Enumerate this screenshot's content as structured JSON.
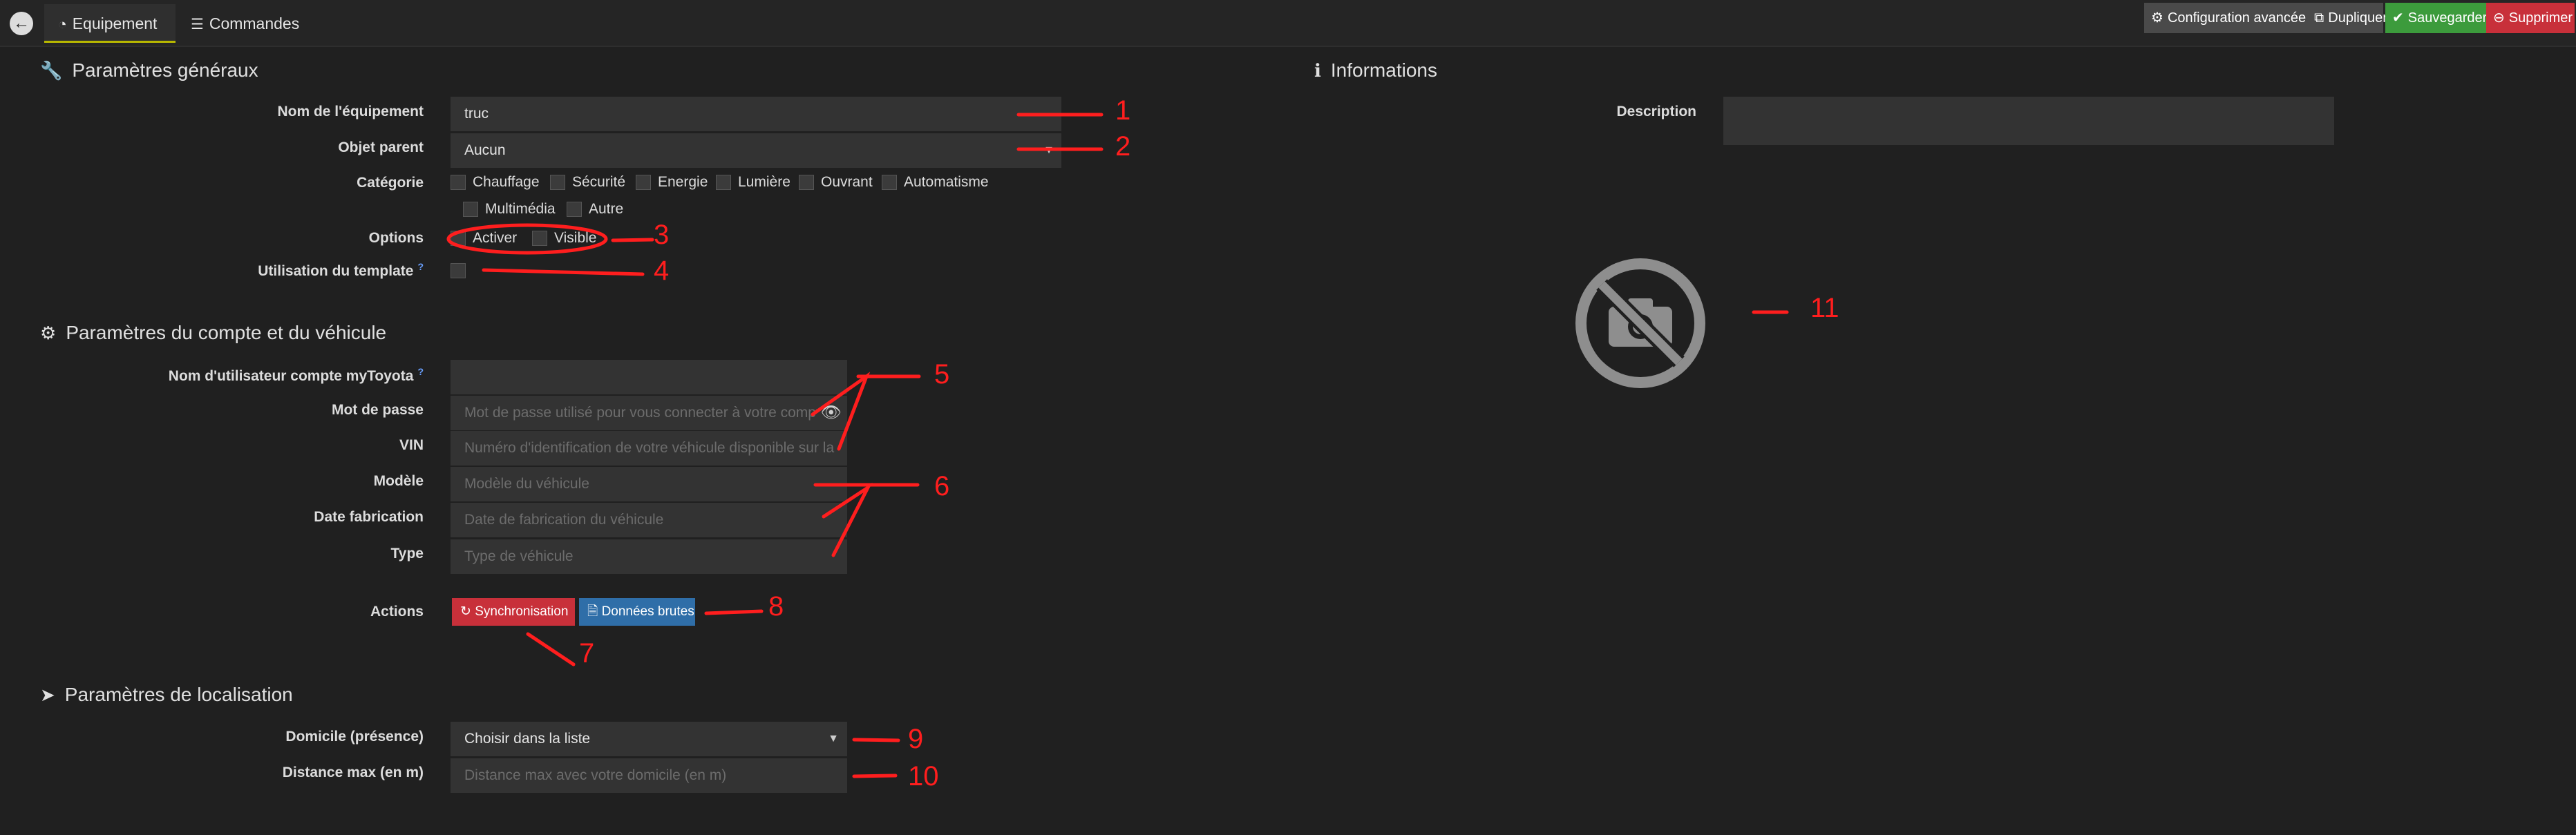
{
  "tabs": [
    {
      "label": "Equipement",
      "icon": "gauge-icon"
    },
    {
      "label": "Commandes",
      "icon": "list-icon"
    }
  ],
  "toolbar": {
    "config_label": "Configuration avancée",
    "duplicate_label": "Dupliquer",
    "save_label": "Sauvegarder",
    "delete_label": "Supprimer",
    "colors": {
      "config": "#4a4a4a",
      "duplicate": "#4a4a4a",
      "save": "#3c9b3c",
      "delete": "#c8303a"
    }
  },
  "general": {
    "title": "Paramètres généraux",
    "name_label": "Nom de l'équipement",
    "name_value": "truc",
    "parent_label": "Objet parent",
    "parent_value": "Aucun",
    "category_label": "Catégorie",
    "categories": [
      "Chauffage",
      "Sécurité",
      "Energie",
      "Lumière",
      "Ouvrant",
      "Automatisme",
      "Multimédia",
      "Autre"
    ],
    "options_label": "Options",
    "opt_activer": "Activer",
    "opt_visible": "Visible",
    "template_label": "Utilisation du template",
    "help_mark": "?"
  },
  "account": {
    "title": "Paramètres du compte et du véhicule",
    "user_label": "Nom d'utilisateur compte myToyota",
    "user_value": "",
    "password_label": "Mot de passe",
    "password_placeholder": "Mot de passe utilisé pour vous connecter à votre compte",
    "vin_label": "VIN",
    "vin_placeholder": "Numéro d'identification de votre véhicule disponible sur la",
    "model_label": "Modèle",
    "model_placeholder": "Modèle du véhicule",
    "date_label": "Date fabrication",
    "date_placeholder": "Date de fabrication du véhicule",
    "type_label": "Type",
    "type_placeholder": "Type de véhicule",
    "actions_label": "Actions",
    "sync_label": "Synchronisation",
    "raw_label": "Données brutes",
    "colors": {
      "sync": "#c8303a",
      "raw": "#2f6ea8"
    }
  },
  "location": {
    "title": "Paramètres de localisation",
    "home_label": "Domicile (présence)",
    "home_value": "Choisir dans la liste",
    "distance_label": "Distance max (en m)",
    "distance_placeholder": "Distance max avec votre domicile (en m)"
  },
  "info": {
    "title": "Informations",
    "description_label": "Description",
    "description_value": ""
  },
  "annotations": [
    "1",
    "2",
    "3",
    "4",
    "5",
    "6",
    "7",
    "8",
    "9",
    "10",
    "11"
  ]
}
